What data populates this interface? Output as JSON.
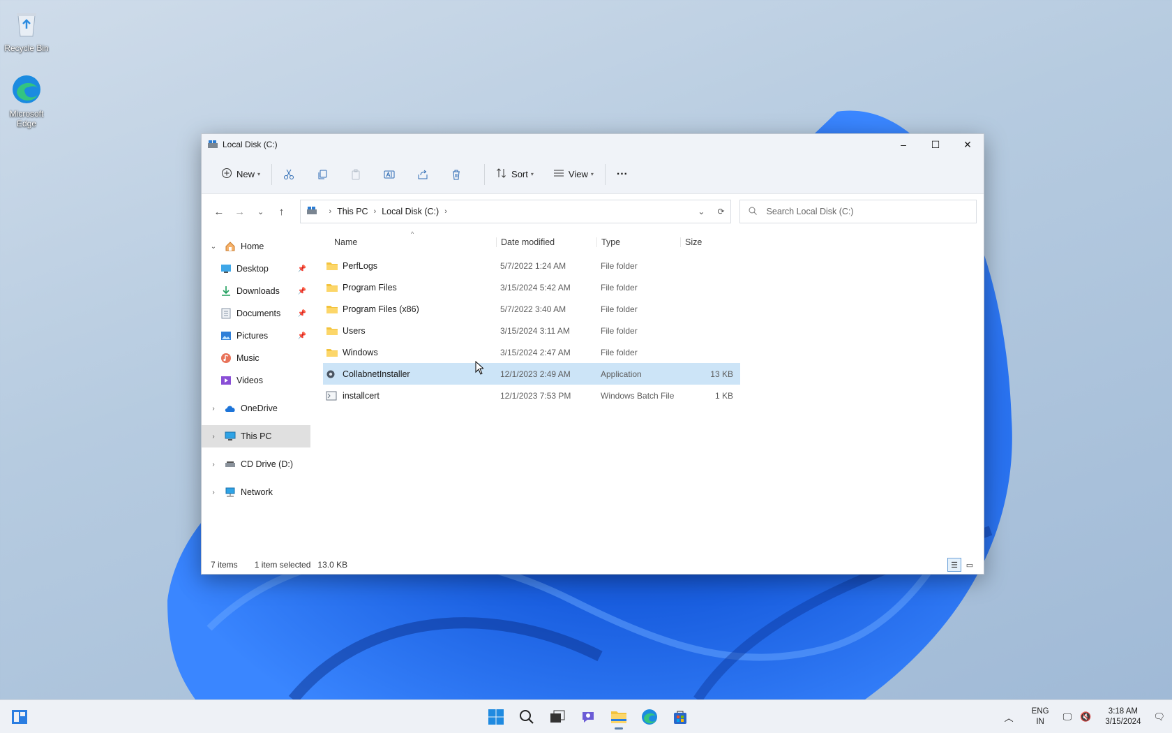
{
  "desktop": {
    "icons": [
      {
        "label": "Recycle Bin",
        "icon": "recycle-bin-icon"
      },
      {
        "label": "Microsoft Edge",
        "icon": "edge-icon"
      }
    ]
  },
  "window": {
    "title": "Local Disk (C:)",
    "controls": {
      "minimize": "–",
      "maximize": "☐",
      "close": "✕"
    }
  },
  "commandbar": {
    "new_label": "New",
    "sort_label": "Sort",
    "view_label": "View",
    "more": "···"
  },
  "address": {
    "crumbs": [
      "This PC",
      "Local Disk (C:)"
    ],
    "search_placeholder": "Search Local Disk (C:)"
  },
  "navpane": {
    "home": "Home",
    "quick": [
      {
        "label": "Desktop",
        "pinned": true
      },
      {
        "label": "Downloads",
        "pinned": true
      },
      {
        "label": "Documents",
        "pinned": true
      },
      {
        "label": "Pictures",
        "pinned": true
      },
      {
        "label": "Music",
        "pinned": false
      },
      {
        "label": "Videos",
        "pinned": false
      }
    ],
    "onedrive": "OneDrive",
    "thispc": "This PC",
    "cddrive": "CD Drive (D:)",
    "network": "Network"
  },
  "columns": {
    "name": "Name",
    "date": "Date modified",
    "type": "Type",
    "size": "Size"
  },
  "files": [
    {
      "name": "PerfLogs",
      "date": "5/7/2022 1:24 AM",
      "type": "File folder",
      "size": "",
      "kind": "folder"
    },
    {
      "name": "Program Files",
      "date": "3/15/2024 5:42 AM",
      "type": "File folder",
      "size": "",
      "kind": "folder"
    },
    {
      "name": "Program Files (x86)",
      "date": "5/7/2022 3:40 AM",
      "type": "File folder",
      "size": "",
      "kind": "folder"
    },
    {
      "name": "Users",
      "date": "3/15/2024 3:11 AM",
      "type": "File folder",
      "size": "",
      "kind": "folder"
    },
    {
      "name": "Windows",
      "date": "3/15/2024 2:47 AM",
      "type": "File folder",
      "size": "",
      "kind": "folder"
    },
    {
      "name": "CollabnetInstaller",
      "date": "12/1/2023 2:49 AM",
      "type": "Application",
      "size": "13 KB",
      "kind": "app",
      "selected": true
    },
    {
      "name": "installcert",
      "date": "12/1/2023 7:53 PM",
      "type": "Windows Batch File",
      "size": "1 KB",
      "kind": "bat"
    }
  ],
  "status": {
    "items": "7 items",
    "selected": "1 item selected",
    "size": "13.0 KB"
  },
  "taskbar": {
    "lang_top": "ENG",
    "lang_bottom": "IN",
    "time": "3:18 AM",
    "date": "3/15/2024"
  }
}
